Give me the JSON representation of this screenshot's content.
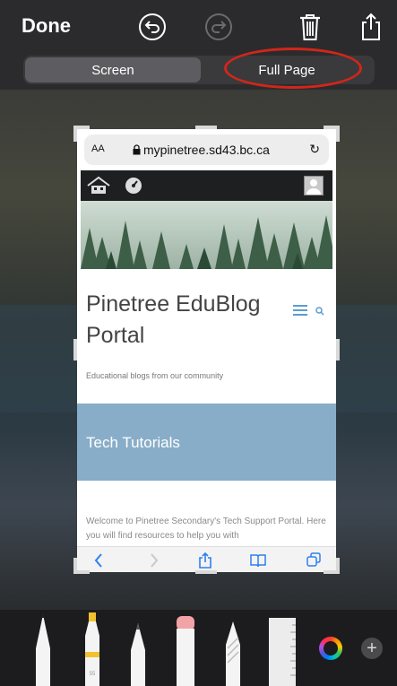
{
  "header": {
    "done_label": "Done",
    "undo_icon": "undo-icon",
    "redo_icon": "redo-icon",
    "trash_icon": "trash-icon",
    "share_icon": "share-icon"
  },
  "segmented": {
    "screen_label": "Screen",
    "full_page_label": "Full Page",
    "selected": "Screen",
    "annotation_color": "#d1261a"
  },
  "preview": {
    "aa_label": "AA",
    "url": "mypinetree.sd43.bc.ca",
    "site_title": "Pinetree EduBlog Portal",
    "tagline": "Educational blogs from our community",
    "section_title": "Tech Tutorials",
    "body_text": "Welcome to Pinetree Secondary's Tech Support Portal. Here you will find resources to help you with"
  },
  "markup_tools": {
    "items": [
      "pen",
      "highlighter",
      "pencil",
      "eraser",
      "lasso",
      "ruler"
    ],
    "highlighter_number": "55"
  }
}
